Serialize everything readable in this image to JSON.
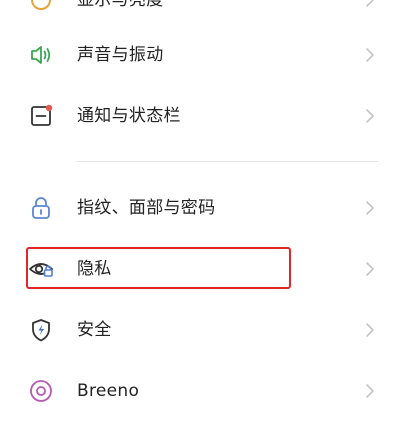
{
  "colors": {
    "sound_icon": "#3aa655",
    "notification_icon": "#e05a4e",
    "lock_icon": "#5b86d6",
    "privacy_icon": "#4f7fd6",
    "security_icon": "#3a6fd8",
    "breeno_icon": "#b55ab2",
    "highlight_border": "#e0282c",
    "chevron": "#c5c5c5"
  },
  "settings": {
    "items": [
      {
        "label": "显示与亮度",
        "icon": "display-icon"
      },
      {
        "label": "声音与振动",
        "icon": "speaker-icon"
      },
      {
        "label": "通知与状态栏",
        "icon": "notification-icon"
      },
      {
        "label": "指纹、面部与密码",
        "icon": "lock-icon"
      },
      {
        "label": "隐私",
        "icon": "privacy-eye-icon"
      },
      {
        "label": "安全",
        "icon": "shield-icon"
      },
      {
        "label": "Breeno",
        "icon": "breeno-icon"
      }
    ]
  }
}
